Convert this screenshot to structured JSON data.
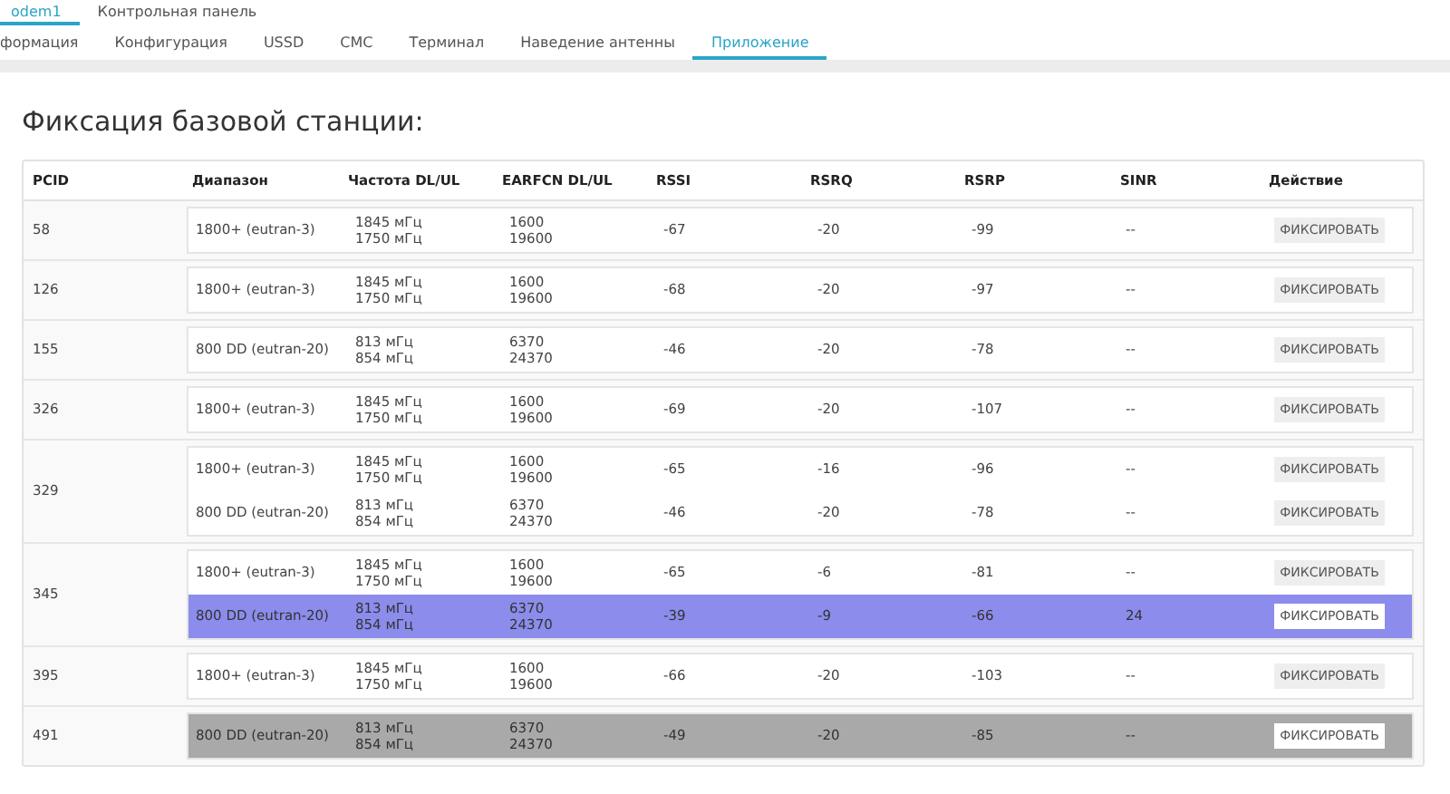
{
  "top_tabs": [
    {
      "label": "odem1",
      "selected": true
    },
    {
      "label": "Контрольная панель",
      "selected": false
    }
  ],
  "tabs": [
    {
      "label": "формация",
      "selected": false
    },
    {
      "label": "Конфигурация",
      "selected": false
    },
    {
      "label": "USSD",
      "selected": false
    },
    {
      "label": "СМС",
      "selected": false
    },
    {
      "label": "Терминал",
      "selected": false
    },
    {
      "label": "Наведение антенны",
      "selected": false
    },
    {
      "label": "Приложение",
      "selected": true
    }
  ],
  "title": "Фиксация базовой станции:",
  "table": {
    "columns": [
      "PCID",
      "Диапазон",
      "Частота DL/UL",
      "EARFCN DL/UL",
      "RSSI",
      "RSRQ",
      "RSRP",
      "SINR",
      "Действие"
    ],
    "groups": [
      {
        "pcid": "58",
        "cells": [
          {
            "band": "1800+ (eutran-3)",
            "freq": [
              "1845 мГц",
              "1750 мГц"
            ],
            "earfcn": [
              "1600",
              "19600"
            ],
            "rssi": "-67",
            "rsrq": "-20",
            "rsrp": "-99",
            "sinr": "--",
            "action": "ФИКСИРОВАТЬ"
          }
        ]
      },
      {
        "pcid": "126",
        "cells": [
          {
            "band": "1800+ (eutran-3)",
            "freq": [
              "1845 мГц",
              "1750 мГц"
            ],
            "earfcn": [
              "1600",
              "19600"
            ],
            "rssi": "-68",
            "rsrq": "-20",
            "rsrp": "-97",
            "sinr": "--",
            "action": "ФИКСИРОВАТЬ"
          }
        ]
      },
      {
        "pcid": "155",
        "cells": [
          {
            "band": "800 DD (eutran-20)",
            "freq": [
              "813 мГц",
              "854 мГц"
            ],
            "earfcn": [
              "6370",
              "24370"
            ],
            "rssi": "-46",
            "rsrq": "-20",
            "rsrp": "-78",
            "sinr": "--",
            "action": "ФИКСИРОВАТЬ"
          }
        ]
      },
      {
        "pcid": "326",
        "cells": [
          {
            "band": "1800+ (eutran-3)",
            "freq": [
              "1845 мГц",
              "1750 мГц"
            ],
            "earfcn": [
              "1600",
              "19600"
            ],
            "rssi": "-69",
            "rsrq": "-20",
            "rsrp": "-107",
            "sinr": "--",
            "action": "ФИКСИРОВАТЬ"
          }
        ]
      },
      {
        "pcid": "329",
        "cells": [
          {
            "band": "1800+ (eutran-3)",
            "freq": [
              "1845 мГц",
              "1750 мГц"
            ],
            "earfcn": [
              "1600",
              "19600"
            ],
            "rssi": "-65",
            "rsrq": "-16",
            "rsrp": "-96",
            "sinr": "--",
            "action": "ФИКСИРОВАТЬ"
          },
          {
            "band": "800 DD (eutran-20)",
            "freq": [
              "813 мГц",
              "854 мГц"
            ],
            "earfcn": [
              "6370",
              "24370"
            ],
            "rssi": "-46",
            "rsrq": "-20",
            "rsrp": "-78",
            "sinr": "--",
            "action": "ФИКСИРОВАТЬ"
          }
        ]
      },
      {
        "pcid": "345",
        "cells": [
          {
            "band": "1800+ (eutran-3)",
            "freq": [
              "1845 мГц",
              "1750 мГц"
            ],
            "earfcn": [
              "1600",
              "19600"
            ],
            "rssi": "-65",
            "rsrq": "-6",
            "rsrp": "-81",
            "sinr": "--",
            "action": "ФИКСИРОВАТЬ"
          },
          {
            "band": "800 DD (eutran-20)",
            "freq": [
              "813 мГц",
              "854 мГц"
            ],
            "earfcn": [
              "6370",
              "24370"
            ],
            "rssi": "-39",
            "rsrq": "-9",
            "rsrp": "-66",
            "sinr": "24",
            "action": "ФИКСИРОВАТЬ",
            "color": "#8c8cec"
          }
        ]
      },
      {
        "pcid": "395",
        "cells": [
          {
            "band": "1800+ (eutran-3)",
            "freq": [
              "1845 мГц",
              "1750 мГц"
            ],
            "earfcn": [
              "1600",
              "19600"
            ],
            "rssi": "-66",
            "rsrq": "-20",
            "rsrp": "-103",
            "sinr": "--",
            "action": "ФИКСИРОВАТЬ"
          }
        ]
      },
      {
        "pcid": "491",
        "cells": [
          {
            "band": "800 DD (eutran-20)",
            "freq": [
              "813 мГц",
              "854 мГц"
            ],
            "earfcn": [
              "6370",
              "24370"
            ],
            "rssi": "-49",
            "rsrq": "-20",
            "rsrp": "-85",
            "sinr": "--",
            "action": "ФИКСИРОВАТЬ",
            "color": "#a9a9a9"
          }
        ]
      }
    ]
  }
}
